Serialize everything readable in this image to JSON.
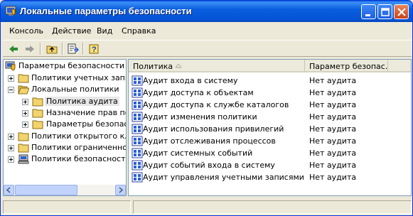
{
  "window": {
    "title": "Локальные параметры безопасности"
  },
  "menu": [
    "Консоль",
    "Действие",
    "Вид",
    "Справка"
  ],
  "toolbar": {
    "buttons": [
      "back-icon",
      "forward-icon",
      "up-folder-icon",
      "export-list-icon",
      "help-icon"
    ]
  },
  "tree": {
    "root": "Параметры безопасности",
    "items": [
      {
        "label": "Политики учетных записей",
        "level": 1,
        "expander": "plus",
        "icon": "folder"
      },
      {
        "label": "Локальные политики",
        "level": 1,
        "expander": "minus",
        "icon": "folder-open"
      },
      {
        "label": "Политика аудита",
        "level": 2,
        "expander": "plus",
        "icon": "folder",
        "selected": true
      },
      {
        "label": "Назначение прав пользователя",
        "level": 2,
        "expander": "plus",
        "icon": "folder"
      },
      {
        "label": "Параметры безопасности",
        "level": 2,
        "expander": "plus",
        "icon": "folder"
      },
      {
        "label": "Политики открытого ключа",
        "level": 1,
        "expander": "plus",
        "icon": "folder"
      },
      {
        "label": "Политики ограниченного использования программ",
        "level": 1,
        "expander": "plus",
        "icon": "folder"
      },
      {
        "label": "Политики безопасности IP",
        "level": 1,
        "expander": "plus",
        "icon": "computer"
      }
    ]
  },
  "list": {
    "columns": [
      "Политика",
      "Параметр безопас..."
    ],
    "rows": [
      {
        "policy": "Аудит входа в систему",
        "setting": "Нет аудита"
      },
      {
        "policy": "Аудит доступа к объектам",
        "setting": "Нет аудита"
      },
      {
        "policy": "Аудит доступа к службе каталогов",
        "setting": "Нет аудита"
      },
      {
        "policy": "Аудит изменения политики",
        "setting": "Нет аудита"
      },
      {
        "policy": "Аудит использования привилегий",
        "setting": "Нет аудита"
      },
      {
        "policy": "Аудит отслеживания процессов",
        "setting": "Нет аудита"
      },
      {
        "policy": "Аудит системных событий",
        "setting": "Нет аудита"
      },
      {
        "policy": "Аудит событий входа в систему",
        "setting": "Нет аудита"
      },
      {
        "policy": "Аудит управления учетными записями",
        "setting": "Нет аудита"
      }
    ]
  }
}
